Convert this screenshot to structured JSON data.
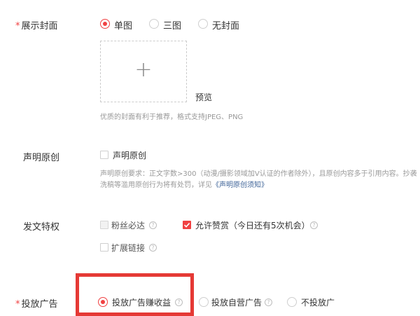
{
  "cover": {
    "label": "展示封面",
    "required_mark": "*",
    "options": [
      "单图",
      "三图",
      "无封面"
    ],
    "selected": "单图",
    "upload_symbol": "+",
    "preview_label": "预览",
    "hint": "优质的封面有利于推荐，格式支持JPEG、PNG"
  },
  "original": {
    "label": "声明原创",
    "checkbox_label": "声明原创",
    "hint_line1": "声明原创要求：正文字数>300（动漫/摄影领域加V认证的作者除外），且原创内容多于引用内容。抄袭",
    "hint_line2_prefix": "洗稿等滥用原创行为将有处罚，详见",
    "hint_link": "《声明原创须知》"
  },
  "privileges": {
    "label": "发文特权",
    "fans_label": "粉丝必达",
    "reward_label": "允许赞赏（今日还有5次机会）",
    "extend_label": "扩展链接",
    "help_glyph": "?"
  },
  "ads": {
    "label": "投放广告",
    "required_mark": "*",
    "options": [
      "投放广告赚收益",
      "投放自营广告",
      "不投放广"
    ],
    "selected": "投放广告赚收益",
    "help_glyph": "?"
  },
  "colors": {
    "accent": "#f04142",
    "highlight_frame": "#e53935",
    "link": "#406599"
  }
}
